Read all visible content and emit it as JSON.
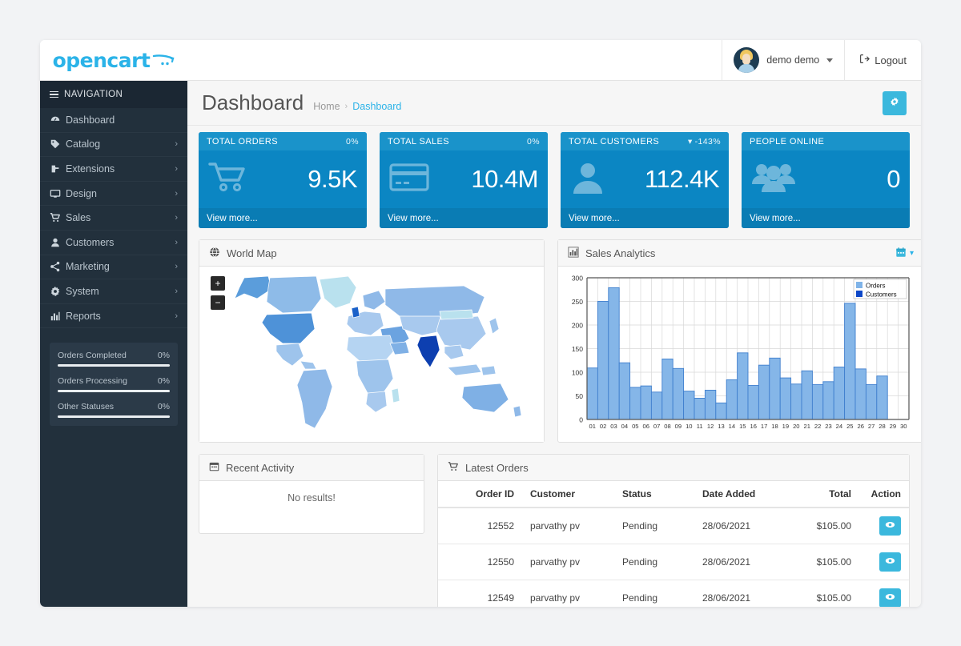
{
  "brand": {
    "name": "opencart",
    "logo_color": "#2bb3e8"
  },
  "topbar": {
    "user_name": "demo demo",
    "logout_label": "Logout",
    "avatar_name": "user-avatar"
  },
  "sidebar": {
    "nav_header": "NAVIGATION",
    "items": [
      {
        "label": "Dashboard",
        "icon": "dashboard-icon",
        "arrow": ""
      },
      {
        "label": "Catalog",
        "icon": "tag-icon",
        "arrow": "›"
      },
      {
        "label": "Extensions",
        "icon": "puzzle-icon",
        "arrow": "›"
      },
      {
        "label": "Design",
        "icon": "monitor-icon",
        "arrow": "›"
      },
      {
        "label": "Sales",
        "icon": "cart-icon",
        "arrow": "›"
      },
      {
        "label": "Customers",
        "icon": "user-icon",
        "arrow": "›"
      },
      {
        "label": "Marketing",
        "icon": "share-icon",
        "arrow": "›"
      },
      {
        "label": "System",
        "icon": "gear-icon",
        "arrow": "›"
      },
      {
        "label": "Reports",
        "icon": "bar-chart-icon",
        "arrow": "›"
      }
    ],
    "progress": [
      {
        "label": "Orders Completed",
        "value": "0%",
        "percent": 0
      },
      {
        "label": "Orders Processing",
        "value": "0%",
        "percent": 0
      },
      {
        "label": "Other Statuses",
        "value": "0%",
        "percent": 0
      }
    ]
  },
  "page": {
    "title": "Dashboard",
    "breadcrumb": {
      "home": "Home",
      "sep": "›",
      "current": "Dashboard"
    },
    "settings_button_icon": "gear-icon"
  },
  "tiles": [
    {
      "title": "TOTAL ORDERS",
      "pct": "0%",
      "trend": "",
      "value": "9.5K",
      "footer": "View more...",
      "icon": "shopping-cart-icon"
    },
    {
      "title": "TOTAL SALES",
      "pct": "0%",
      "trend": "",
      "value": "10.4M",
      "footer": "View more...",
      "icon": "credit-card-icon"
    },
    {
      "title": "TOTAL CUSTOMERS",
      "pct": "-143%",
      "trend": "▾",
      "value": "112.4K",
      "footer": "View more...",
      "icon": "person-icon"
    },
    {
      "title": "PEOPLE ONLINE",
      "pct": "",
      "trend": "",
      "value": "0",
      "footer": "View more...",
      "icon": "people-icon"
    }
  ],
  "map_panel": {
    "title": "World Map",
    "icon": "globe-icon",
    "zoom_in": "+",
    "zoom_out": "−"
  },
  "activity_panel": {
    "title": "Recent Activity",
    "icon": "calendar-icon",
    "empty_text": "No results!"
  },
  "orders_panel": {
    "title": "Latest Orders",
    "icon": "cart-icon",
    "columns": [
      "Order ID",
      "Customer",
      "Status",
      "Date Added",
      "Total",
      "Action"
    ],
    "rows": [
      {
        "order_id": "12552",
        "customer": "parvathy pv",
        "status": "Pending",
        "date_added": "28/06/2021",
        "total": "$105.00",
        "action_icon": "eye-icon"
      },
      {
        "order_id": "12550",
        "customer": "parvathy pv",
        "status": "Pending",
        "date_added": "28/06/2021",
        "total": "$105.00",
        "action_icon": "eye-icon"
      },
      {
        "order_id": "12549",
        "customer": "parvathy pv",
        "status": "Pending",
        "date_added": "28/06/2021",
        "total": "$105.00",
        "action_icon": "eye-icon"
      }
    ]
  },
  "chart_panel": {
    "title": "Sales Analytics",
    "icon": "bar-chart-icon",
    "range_icon": "calendar-icon",
    "range_caret": "▾"
  },
  "chart_data": {
    "type": "bar",
    "title": "Sales Analytics",
    "xlabel": "",
    "ylabel": "",
    "ylim": [
      0,
      300
    ],
    "yticks": [
      0,
      50,
      100,
      150,
      200,
      250,
      300
    ],
    "grid": true,
    "legend_position": "top-right",
    "categories": [
      "01",
      "02",
      "03",
      "04",
      "05",
      "06",
      "07",
      "08",
      "09",
      "10",
      "11",
      "12",
      "13",
      "14",
      "15",
      "16",
      "17",
      "18",
      "19",
      "20",
      "21",
      "22",
      "23",
      "24",
      "25",
      "26",
      "27",
      "28",
      "29",
      "30"
    ],
    "series": [
      {
        "name": "Orders",
        "color": "#7fb3e8",
        "values": [
          109,
          250,
          279,
          120,
          68,
          71,
          58,
          128,
          108,
          60,
          45,
          62,
          35,
          84,
          141,
          72,
          115,
          130,
          88,
          75,
          103,
          74,
          80,
          111,
          246,
          107,
          74,
          92,
          0,
          0
        ]
      },
      {
        "name": "Customers",
        "color": "#0d47c8",
        "values": [
          0,
          0,
          0,
          0,
          0,
          0,
          0,
          0,
          0,
          0,
          0,
          0,
          0,
          0,
          0,
          0,
          0,
          0,
          0,
          0,
          0,
          0,
          0,
          0,
          0,
          0,
          0,
          0,
          0,
          0
        ]
      }
    ]
  },
  "colors": {
    "tile_bg": "#0b86c3",
    "tile_head": "#1a93ca",
    "tile_foot": "#0a7cb4",
    "accent": "#3bb8dd",
    "sidebar_bg": "#22303c",
    "link": "#2bb3e8"
  }
}
